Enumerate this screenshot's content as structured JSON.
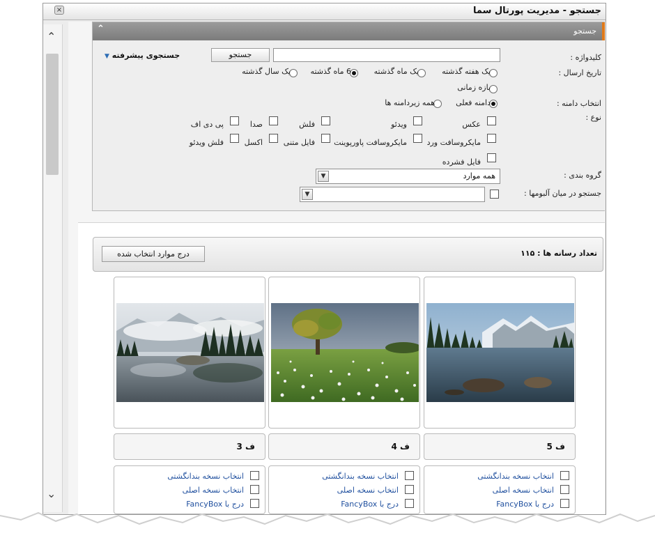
{
  "dialog": {
    "title": "جستجو - مدیریت پورتال سما",
    "close_label": "×"
  },
  "panel": {
    "header": "جستجو",
    "collapse": "⌃"
  },
  "search": {
    "keyword_label": "کلیدواژه :",
    "keyword_value": "",
    "search_button": "جستجو",
    "advanced_link": "جستجوی پیشرفته",
    "date_label": "تاریخ ارسال :",
    "date_options": [
      "یک هفته گذشته",
      "یک ماه گذشته",
      "6 ماه گذشته",
      "یک سال گذشته",
      "بازه زمانی"
    ],
    "date_selected": "6 ماه گذشته",
    "domain_label": "انتخاب دامنه :",
    "domain_options": [
      "دامنه فعلی",
      "همه زیردامنه ها"
    ],
    "domain_selected": "دامنه فعلی",
    "type_label": "نوع :",
    "type_options": [
      "عکس",
      "ویدئو",
      "فلش",
      "صدا",
      "پی دی اف",
      "مایکروسافت ورد",
      "مایکروسافت پاورپوینت",
      "فایل متنی",
      "اکسل",
      "فلش ویدئو",
      "فایل فشرده"
    ],
    "group_label": "گروه بندی :",
    "group_value": "همه موارد",
    "album_label": "جستجو در میان آلبومها :",
    "album_value": ""
  },
  "results": {
    "count_label": "تعداد رسانه ها :",
    "count_value": "۱۱۵",
    "insert_button": "درج موارد انتخاب شده",
    "items": [
      {
        "caption": "ف 5",
        "options": [
          "انتخاب نسخه بندانگشتی",
          "انتخاب نسخه اصلی",
          "درج با FancyBox"
        ]
      },
      {
        "caption": "ف 4",
        "options": [
          "انتخاب نسخه بندانگشتی",
          "انتخاب نسخه اصلی",
          "درج با FancyBox"
        ]
      },
      {
        "caption": "ف 3",
        "options": [
          "انتخاب نسخه بندانگشتی",
          "انتخاب نسخه اصلی",
          "درج با FancyBox"
        ]
      }
    ]
  },
  "scroll": {
    "up": "⌃",
    "down": "⌄"
  }
}
